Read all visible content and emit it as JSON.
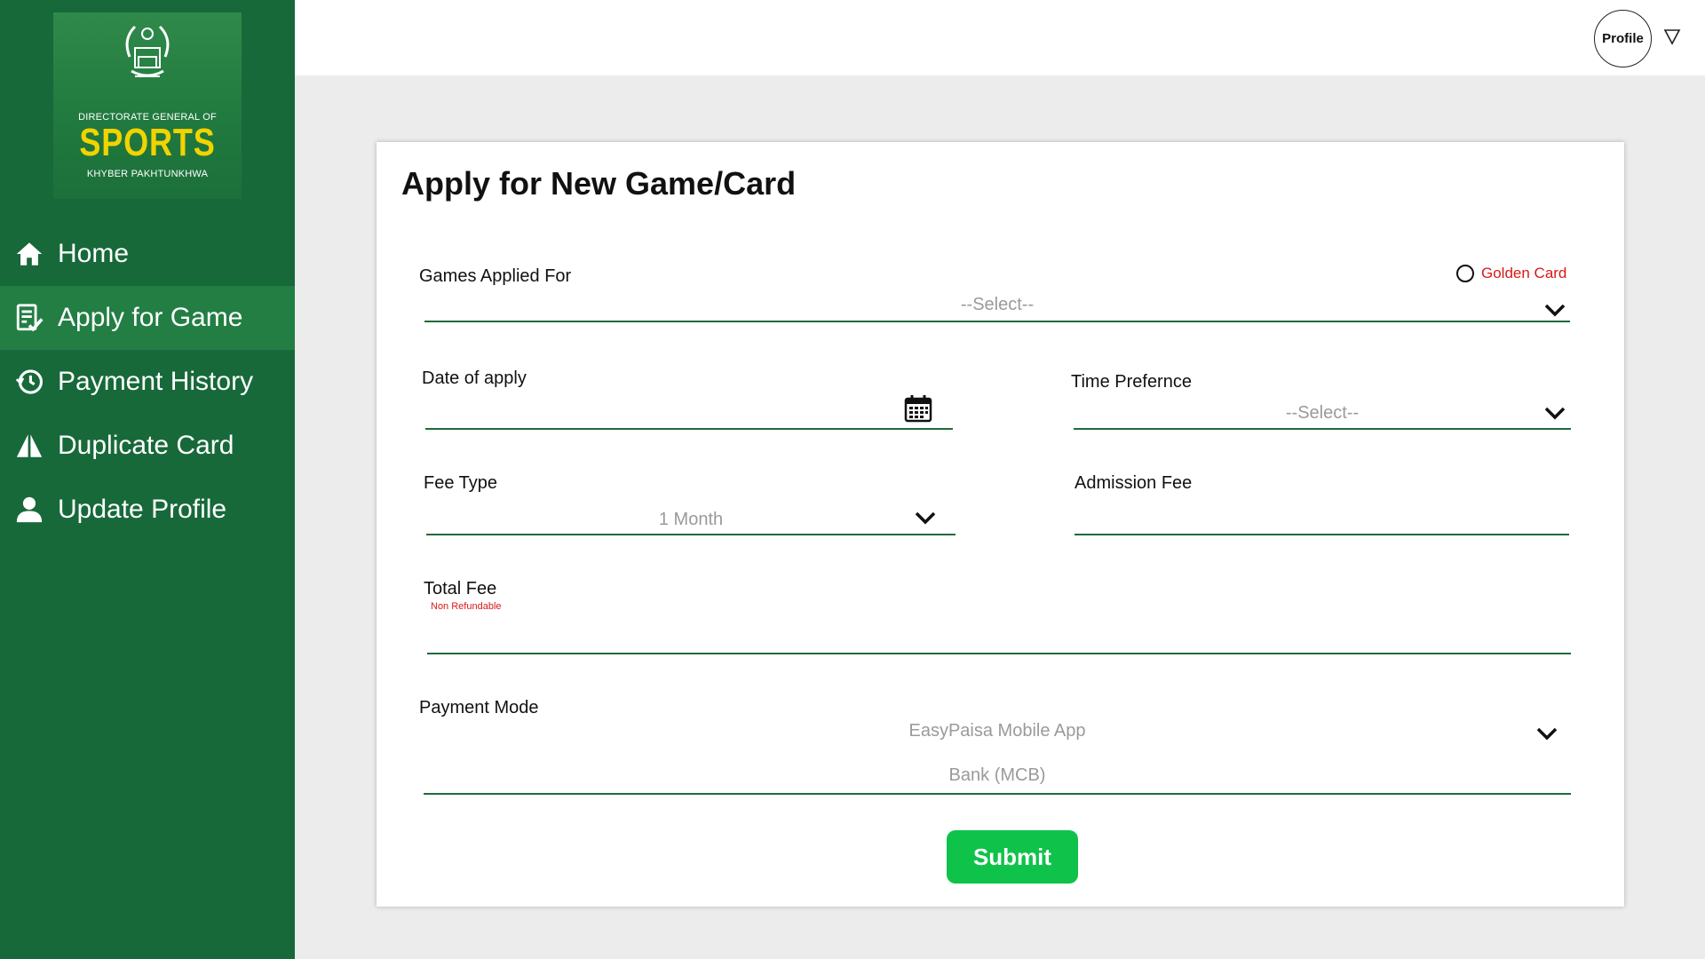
{
  "sidebar": {
    "logo": {
      "line1": "DIRECTORATE GENERAL OF",
      "line2": "SPORTS",
      "line3": "KHYBER PAKHTUNKHWA"
    },
    "items": [
      {
        "label": "Home",
        "icon": "home-icon",
        "active": false
      },
      {
        "label": "Apply for Game",
        "icon": "checklist-icon",
        "active": true
      },
      {
        "label": "Payment History",
        "icon": "history-icon",
        "active": false
      },
      {
        "label": "Duplicate Card",
        "icon": "duplicate-icon",
        "active": false
      },
      {
        "label": "Update Profile",
        "icon": "user-icon",
        "active": false
      }
    ]
  },
  "header": {
    "profile_label": "Profile",
    "caret_icon": "triangle-down-icon"
  },
  "form": {
    "title": "Apply for New Game/Card",
    "games_applied_for": {
      "label": "Games Applied For",
      "value": "--Select--"
    },
    "golden_card": {
      "label": "Golden Card",
      "checked": false
    },
    "date_of_apply": {
      "label": "Date of apply",
      "value": ""
    },
    "time_preference": {
      "label": "Time Prefernce",
      "value": "--Select--"
    },
    "fee_type": {
      "label": "Fee Type",
      "value": "1 Month"
    },
    "admission_fee": {
      "label": "Admission Fee",
      "value": ""
    },
    "total_fee": {
      "label": "Total Fee",
      "note": "Non Refundable",
      "value": ""
    },
    "payment_mode": {
      "label": "Payment Mode",
      "options": [
        "EasyPaisa Mobile App",
        "Bank (MCB)"
      ]
    },
    "submit_label": "Submit"
  },
  "colors": {
    "sidebar_bg": "#17693a",
    "sidebar_active": "#237e44",
    "accent_line": "#1f6b3a",
    "submit_bg": "#0fc24a",
    "warning_text": "#d81818"
  }
}
